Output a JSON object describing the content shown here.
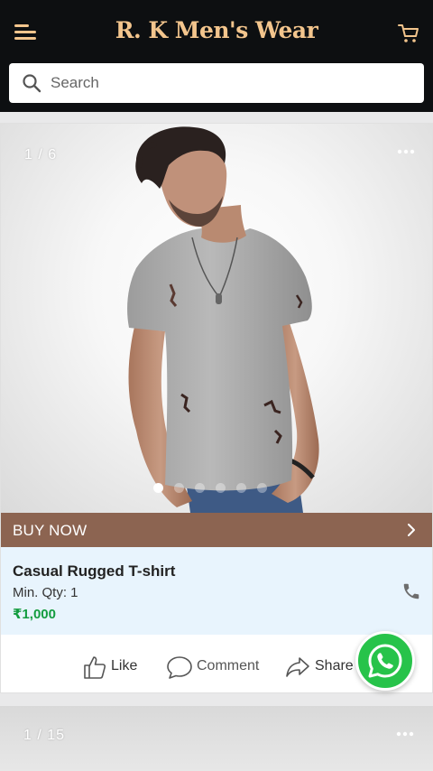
{
  "app": {
    "title": "R. K Men's Wear",
    "brand_color": "#f3c58d",
    "header_bg": "#0d0f11"
  },
  "icons": {
    "menu": "menu-icon",
    "cart": "cart-icon",
    "search": "search-icon",
    "more": "more-icon",
    "phone": "phone-icon",
    "like": "thumbs-up-icon",
    "comment": "comment-icon",
    "share": "share-icon",
    "whatsapp": "whatsapp-icon",
    "chevron": "chevron-right-icon"
  },
  "search": {
    "placeholder": "Search"
  },
  "products": [
    {
      "image_counter": "1 / 6",
      "image_dots_total": 6,
      "image_dots_active_index": 0,
      "cta_label": "BUY NOW",
      "cta_color": "#8c6451",
      "name": "Casual Rugged T-shirt",
      "min_qty": "Min. Qty:  1",
      "price": "₹1,000",
      "price_color": "#139c3f",
      "actions": {
        "like": "Like",
        "comment": "Comment",
        "share": "Share"
      }
    },
    {
      "image_counter": "1 / 15"
    }
  ],
  "whatsapp_color": "#27c34a"
}
